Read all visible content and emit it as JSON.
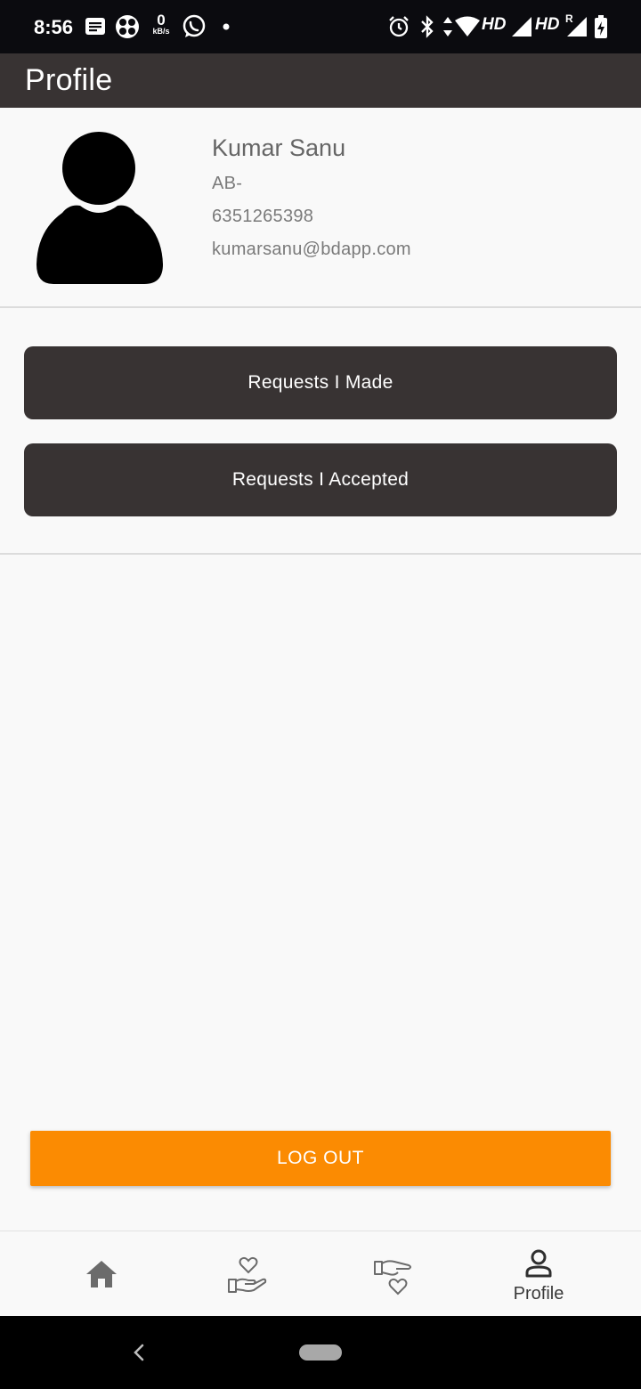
{
  "status_bar": {
    "time": "8:56",
    "net_speed_value": "0",
    "net_speed_unit": "kB/s",
    "hd_label_1": "HD",
    "hd_label_2": "HD",
    "roaming_label": "R",
    "icons": [
      "message-icon",
      "fan-icon",
      "whatsapp-icon",
      "dot-icon",
      "alarm-icon",
      "bluetooth-icon",
      "data-arrows-icon",
      "wifi-icon",
      "signal-icon",
      "signal-icon",
      "battery-charging-icon"
    ]
  },
  "app_bar": {
    "title": "Profile"
  },
  "profile": {
    "name": "Kumar Sanu",
    "blood_group": "AB-",
    "phone": "6351265398",
    "email": "kumarsanu@bdapp.com",
    "avatar_icon": "person-avatar-icon"
  },
  "actions": {
    "requests_made": "Requests I Made",
    "requests_accepted": "Requests I Accepted",
    "logout": "LOG OUT"
  },
  "bottom_nav": {
    "items": [
      {
        "icon": "home-icon",
        "label": ""
      },
      {
        "icon": "hand-heart-icon",
        "label": ""
      },
      {
        "icon": "give-heart-icon",
        "label": ""
      },
      {
        "icon": "person-icon",
        "label": "Profile"
      }
    ]
  },
  "colors": {
    "app_bar": "#383333",
    "logout": "#fb8b02",
    "background": "#f9f9f9"
  }
}
